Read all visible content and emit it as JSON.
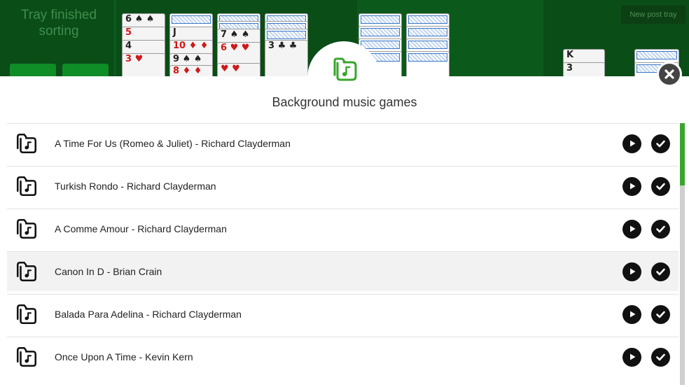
{
  "board": {
    "status_text": "Tray finished sorting",
    "new_post_button": "New post tray",
    "colors": {
      "felt": "#0c5a1b",
      "accent_green": "#3aa52c"
    },
    "cards": [
      {
        "label": "6 ♠ ♠",
        "red": false
      },
      {
        "label": "5",
        "red": true
      },
      {
        "label": "4",
        "red": false
      },
      {
        "label": "3 ♥",
        "red": true
      },
      {
        "label": "J",
        "red": false
      },
      {
        "label": "10 ♦ ♦",
        "red": true
      },
      {
        "label": "9 ♠ ♠",
        "red": false
      },
      {
        "label": "8 ♦ ♦",
        "red": true
      },
      {
        "label": "7 ♠ ♠",
        "red": false
      },
      {
        "label": "6 ♥ ♥",
        "red": true
      },
      {
        "label": "♥ ♥",
        "red": true
      },
      {
        "label": "3 ♣ ♣",
        "red": false
      },
      {
        "label": "K",
        "red": false
      },
      {
        "label": "3",
        "red": false
      }
    ]
  },
  "modal": {
    "title": "Background music games",
    "title_icon": "music-folder-icon",
    "close_icon": "close-icon",
    "tracks": [
      {
        "name": "A Time For Us (Romeo & Juliet) - Richard Clayderman",
        "selected": false
      },
      {
        "name": "Turkish Rondo - Richard Clayderman",
        "selected": false
      },
      {
        "name": "A Comme Amour - Richard Clayderman",
        "selected": false
      },
      {
        "name": "Canon In D - Brian Crain",
        "selected": true
      },
      {
        "name": "Balada Para Adelina - Richard Clayderman",
        "selected": false
      },
      {
        "name": "Once Upon A Time - Kevin Kern",
        "selected": false
      }
    ],
    "row_colors": {
      "normal": "#ffffff",
      "selected": "#f2f2f2"
    },
    "play_icon": "play-icon",
    "check_icon": "check-icon",
    "scroll_position": 0.0
  }
}
